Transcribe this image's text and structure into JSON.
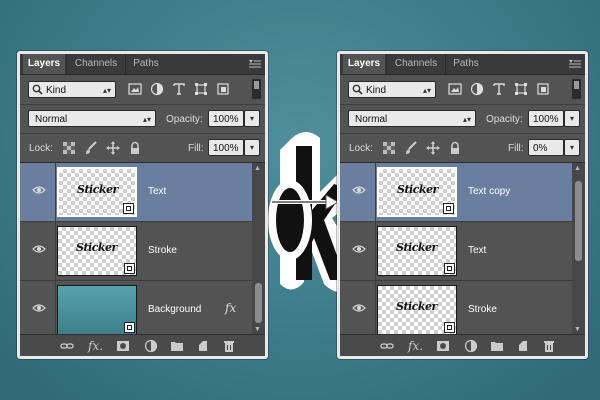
{
  "colors": {
    "background": "#3f7f8d",
    "panel": "#535353",
    "selected_layer": "#6a7fa0",
    "panel_border": "#e8e8e8"
  },
  "left_panel": {
    "tabs": [
      {
        "label": "Layers",
        "active": true
      },
      {
        "label": "Channels",
        "active": false
      },
      {
        "label": "Paths",
        "active": false
      }
    ],
    "kind_filter": {
      "value": "Kind"
    },
    "filter_icons": [
      "image-filter-icon",
      "adjustment-filter-icon",
      "type-filter-icon",
      "shape-filter-icon",
      "smart-object-filter-icon"
    ],
    "blend_mode": "Normal",
    "opacity_label": "Opacity:",
    "opacity_value": "100%",
    "lock_label": "Lock:",
    "lock_icons": [
      "lock-transparent-icon",
      "lock-image-icon",
      "lock-position-icon",
      "lock-all-icon"
    ],
    "fill_label": "Fill:",
    "fill_value": "100%",
    "layers": [
      {
        "name": "Text",
        "thumb_text": "Sticker",
        "selected": true,
        "visible": true
      },
      {
        "name": "Stroke",
        "thumb_text": "Sticker",
        "selected": false,
        "visible": true
      },
      {
        "name": "Background",
        "thumb_text": "",
        "selected": false,
        "visible": true,
        "fx": "fx"
      }
    ],
    "footer_icons": [
      "link-icon",
      "fx-icon",
      "mask-icon",
      "adjustment-icon",
      "folder-icon",
      "new-layer-icon",
      "trash-icon"
    ]
  },
  "right_panel": {
    "tabs": [
      {
        "label": "Layers",
        "active": true
      },
      {
        "label": "Channels",
        "active": false
      },
      {
        "label": "Paths",
        "active": false
      }
    ],
    "kind_filter": {
      "value": "Kind"
    },
    "filter_icons": [
      "image-filter-icon",
      "adjustment-filter-icon",
      "type-filter-icon",
      "shape-filter-icon",
      "smart-object-filter-icon"
    ],
    "blend_mode": "Normal",
    "opacity_label": "Opacity:",
    "opacity_value": "100%",
    "lock_label": "Lock:",
    "lock_icons": [
      "lock-transparent-icon",
      "lock-image-icon",
      "lock-position-icon",
      "lock-all-icon"
    ],
    "fill_label": "Fill:",
    "fill_value": "0%",
    "layers": [
      {
        "name": "Text copy",
        "thumb_text": "Sticker",
        "selected": true,
        "visible": true
      },
      {
        "name": "Text",
        "thumb_text": "Sticker",
        "selected": false,
        "visible": true
      },
      {
        "name": "Stroke",
        "thumb_text": "Sticker",
        "selected": false,
        "visible": true
      }
    ],
    "footer_icons": [
      "link-icon",
      "fx-icon",
      "mask-icon",
      "adjustment-icon",
      "folder-icon",
      "new-layer-icon",
      "trash-icon"
    ]
  },
  "center": {
    "graphic_icon": "sticker-k-letter-icon",
    "arrow_icon": "arrow-right-icon"
  }
}
